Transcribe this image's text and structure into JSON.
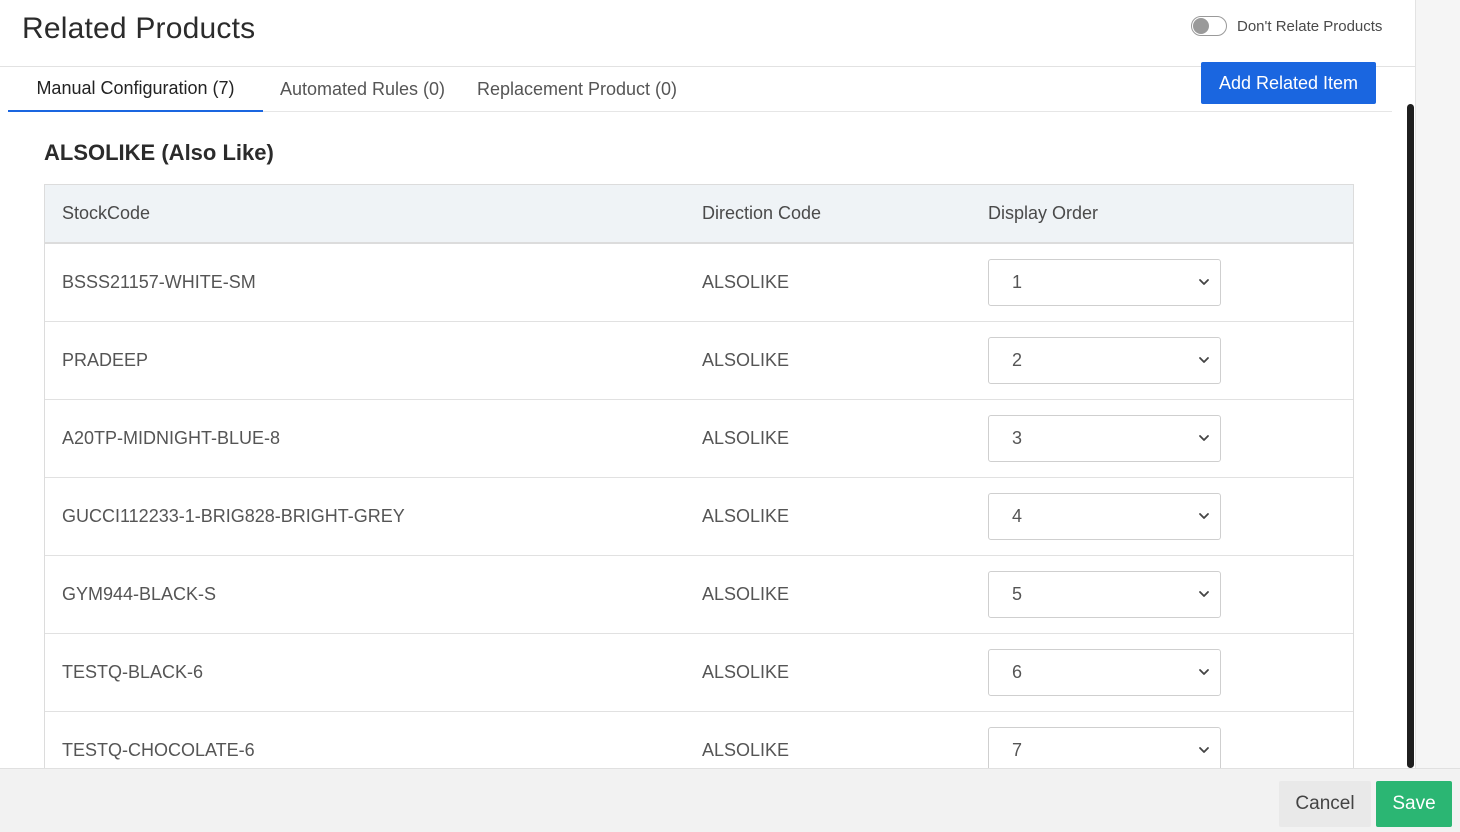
{
  "header": {
    "title": "Related Products",
    "toggle_label": "Don't Relate Products",
    "toggle_on": false
  },
  "tabs": [
    {
      "label": "Manual Configuration (7)",
      "active": true
    },
    {
      "label": "Automated Rules (0)",
      "active": false
    },
    {
      "label": "Replacement Product (0)",
      "active": false
    }
  ],
  "actions": {
    "add_label": "Add Related Item"
  },
  "section": {
    "code": "ALSOLIKE",
    "name": "(Also Like)"
  },
  "table": {
    "columns": [
      "StockCode",
      "Direction Code",
      "Display Order"
    ],
    "rows": [
      {
        "stock_code": "BSSS21157-WHITE-SM",
        "direction": "ALSOLIKE",
        "order": "1"
      },
      {
        "stock_code": "PRADEEP",
        "direction": "ALSOLIKE",
        "order": "2"
      },
      {
        "stock_code": "A20TP-MIDNIGHT-BLUE-8",
        "direction": "ALSOLIKE",
        "order": "3"
      },
      {
        "stock_code": "GUCCI112233-1-BRIG828-BRIGHT-GREY",
        "direction": "ALSOLIKE",
        "order": "4"
      },
      {
        "stock_code": "GYM944-BLACK-S",
        "direction": "ALSOLIKE",
        "order": "5"
      },
      {
        "stock_code": "TESTQ-BLACK-6",
        "direction": "ALSOLIKE",
        "order": "6"
      },
      {
        "stock_code": "TESTQ-CHOCOLATE-6",
        "direction": "ALSOLIKE",
        "order": "7"
      }
    ]
  },
  "footer": {
    "cancel_label": "Cancel",
    "save_label": "Save"
  },
  "colors": {
    "primary": "#1a66e0",
    "save": "#2bb673"
  },
  "icons": {
    "select": "chevron-down-icon"
  }
}
